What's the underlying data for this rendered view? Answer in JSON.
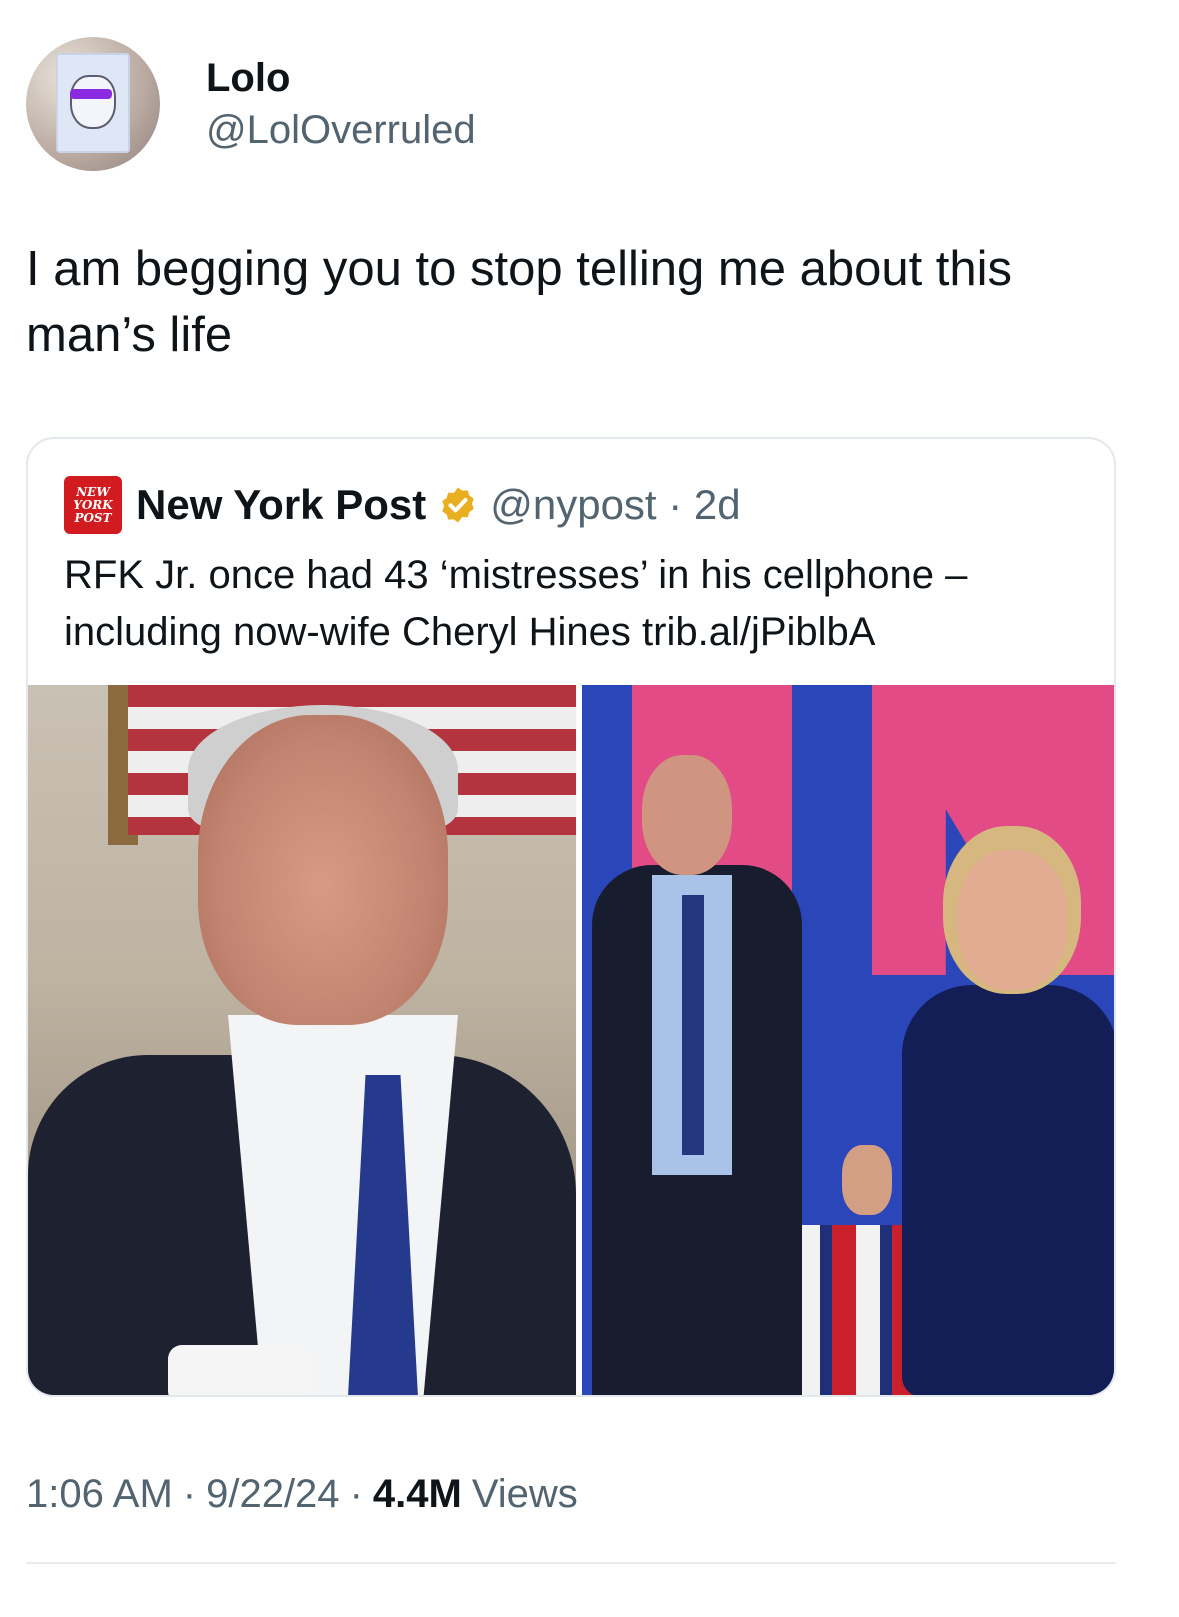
{
  "author": {
    "name": "Lolo",
    "handle": "@LolOverruled"
  },
  "tweet": {
    "text": "I am begging you to stop telling me about this man’s life"
  },
  "quote": {
    "logo_lines": [
      "NEW",
      "YORK",
      "POST"
    ],
    "name": "New York Post",
    "handle_time": "@nypost · 2d",
    "text": "RFK Jr. once had 43 ‘mistresses’ in his cellphone – including now-wife Cheryl Hines trib.al/jPiblbA",
    "verified_color": "#E8B020",
    "logo_color": "#D11B1F"
  },
  "meta": {
    "time": "1:06 AM",
    "date": "9/22/24",
    "views_count": "4.4M",
    "views_label": "Views",
    "separator": "·"
  }
}
